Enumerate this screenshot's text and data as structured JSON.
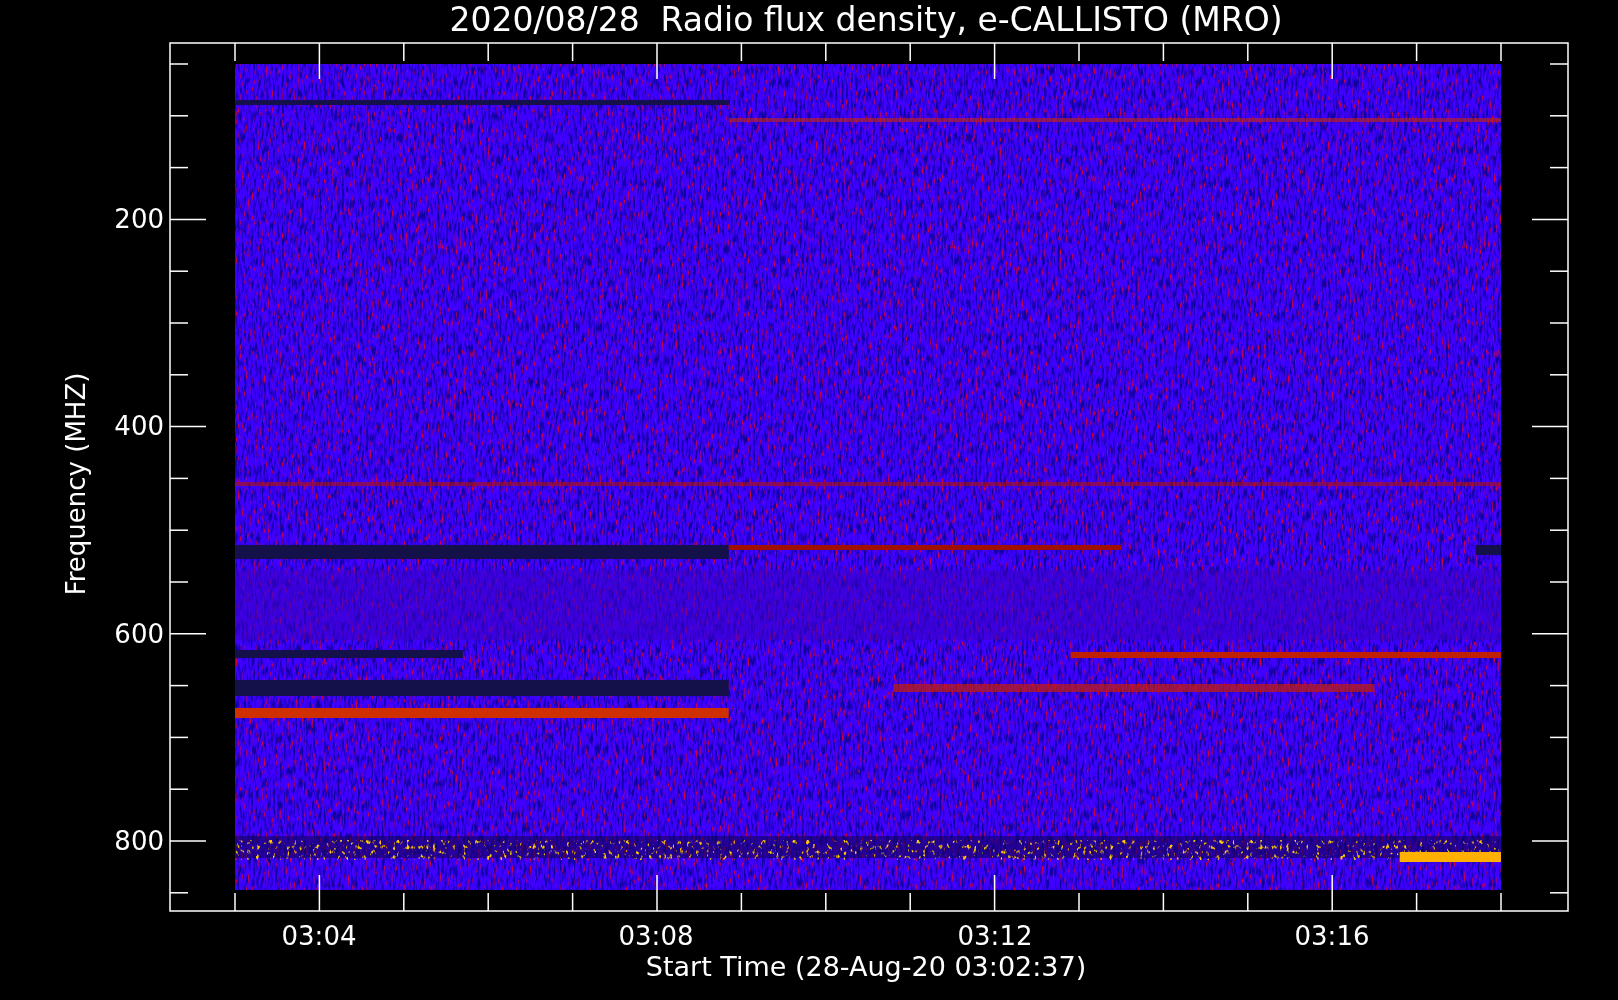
{
  "title": "2020/08/28  Radio flux density, e-CALLISTO (MRO)",
  "y_axis": {
    "label": "Frequency (MHZ)",
    "ticks": [
      "200",
      "400",
      "600",
      "800"
    ]
  },
  "x_axis": {
    "label": "Start Time (28-Aug-20 03:02:37)",
    "ticks": [
      "03:04",
      "03:08",
      "03:12",
      "03:16"
    ]
  }
}
